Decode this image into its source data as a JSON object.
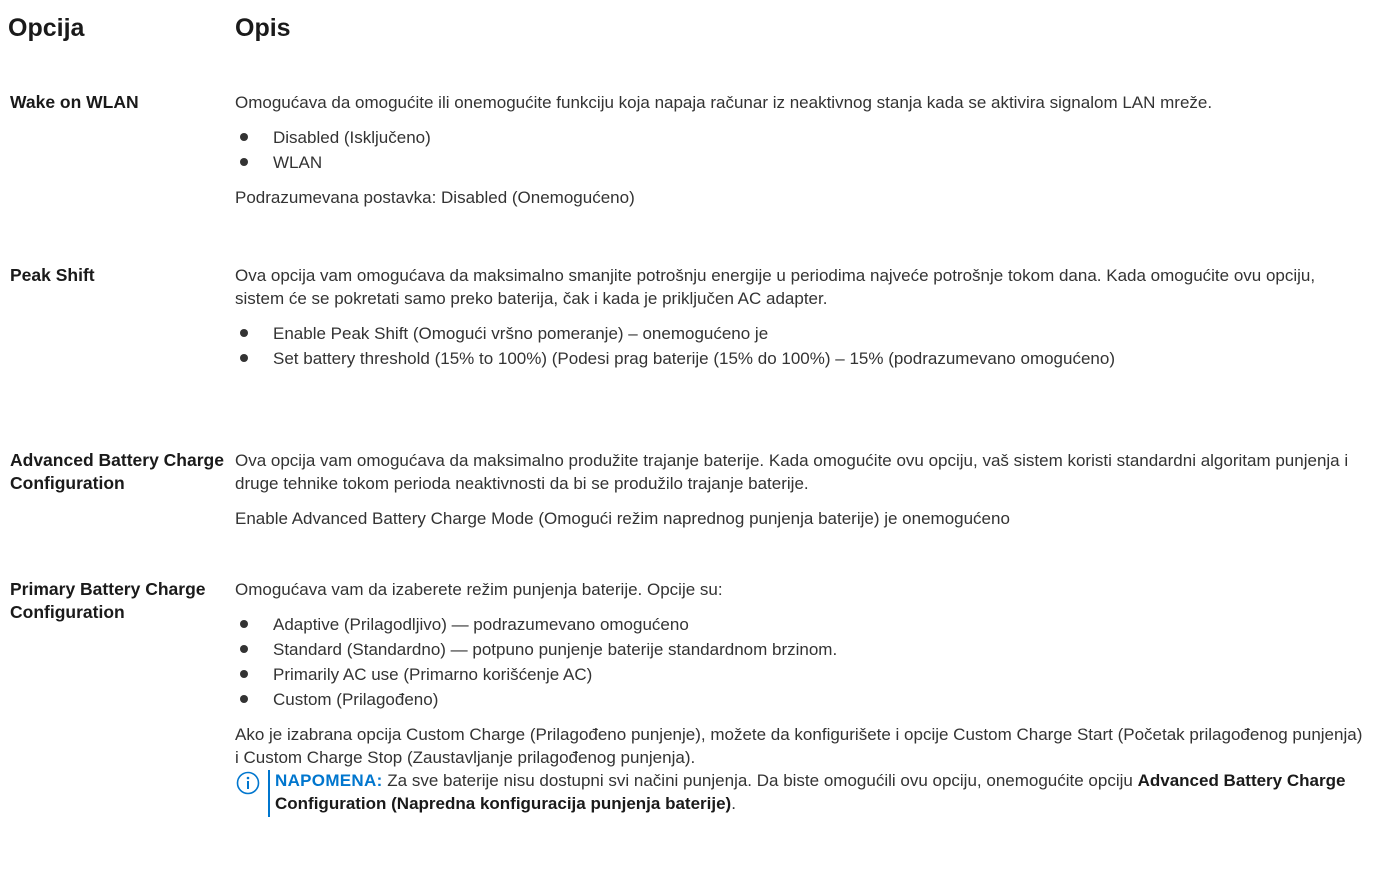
{
  "header": {
    "option": "Opcija",
    "description": "Opis"
  },
  "rows": [
    {
      "option": "Wake on WLAN",
      "text": "Omogućava da omogućite ili onemogućite funkciju koja napaja računar iz neaktivnog stanja kada se aktivira signalom LAN mreže.",
      "bullets": [
        "Disabled (Isključeno)",
        "WLAN"
      ],
      "footer": "Podrazumevana postavka: Disabled (Onemogućeno)"
    },
    {
      "option": "Peak Shift",
      "text": "Ova opcija vam omogućava da maksimalno smanjite potrošnju energije u periodima najveće potrošnje tokom dana. Kada omogućite ovu opciju, sistem će se pokretati samo preko baterija, čak i kada je priključen AC adapter.",
      "bullets": [
        "Enable Peak Shift (Omogući vršno pomeranje) – onemogućeno je",
        "Set battery threshold (15% to 100%) (Podesi prag baterije (15% do 100%) – 15% (podrazumevano omogućeno)"
      ]
    },
    {
      "option": "Advanced Battery Charge Configuration",
      "text": "Ova opcija vam omogućava da maksimalno produžite trajanje baterije. Kada omogućite ovu opciju, vaš sistem koristi standardni algoritam punjenja i druge tehnike tokom perioda neaktivnosti da bi se produžilo trajanje baterije.",
      "footer": "Enable Advanced Battery Charge Mode (Omogući režim naprednog punjenja baterije) je onemogućeno"
    },
    {
      "option": "Primary Battery Charge Configuration",
      "text": "Omogućava vam da izaberete režim punjenja baterije. Opcije su:",
      "bullets": [
        "Adaptive (Prilagodljivo) — podrazumevano omogućeno",
        "Standard (Standardno) — potpuno punjenje baterije standardnom brzinom.",
        "Primarily AC use (Primarno korišćenje AC)",
        "Custom (Prilagođeno)"
      ],
      "footer": "Ako je izabrana opcija Custom Charge (Prilagođeno punjenje), možete da konfigurišete i opcije Custom Charge Start (Početak prilagođenog punjenja) i Custom Charge Stop (Zaustavljanje prilagođenog punjenja).",
      "note": {
        "icon": "info-circle-icon",
        "label": "NAPOMENA:",
        "text": " Za sve baterije nisu dostupni svi načini punjenja. Da biste omogućili ovu opciju, onemogućite opciju ",
        "bold": "Advanced Battery Charge Configuration (Napredna konfiguracija punjenja baterije)",
        "end": "."
      }
    }
  ]
}
